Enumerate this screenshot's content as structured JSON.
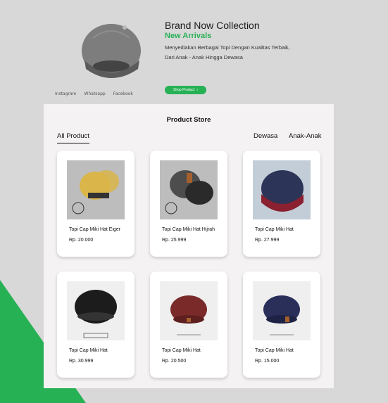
{
  "hero": {
    "title": "Brand Now Collection",
    "subtitle": "New Arrivals",
    "description": "Menyediakan Berbagai Topi Dengan Kualitas Terbaik, Dari Anak - Anak Hingga Dewasa",
    "shop_button": "Shop Product",
    "shop_button_icon": "chevron-right-icon"
  },
  "socials": [
    "Instagram",
    "Whatsapp",
    "Facebook"
  ],
  "store": {
    "title": "Product Store",
    "tabs": [
      "All Product",
      "Dewasa",
      "Anak-Anak"
    ]
  },
  "products": [
    {
      "name": "Topi Cap Miki Hat Eiger",
      "price": "Rp. 20.000",
      "cap_color": "#d9b54a"
    },
    {
      "name": "Topi Cap Miki Hat Hijrah",
      "price": "Rp. 25.999",
      "cap_color": "#4d4d4d"
    },
    {
      "name": "Topi Cap Miki Hat",
      "price": "Rp. 27.999",
      "cap_color": "#2c3557"
    },
    {
      "name": "Topi Cap Miki Hat",
      "price": "Rp. 30.999",
      "cap_color": "#1c1c1c"
    },
    {
      "name": "Topi Cap Miki Hat",
      "price": "Rp. 20.500",
      "cap_color": "#7b2a2a"
    },
    {
      "name": "Topi Cap Miki Hat",
      "price": "Rp. 15.000",
      "cap_color": "#2a2f5a"
    }
  ],
  "colors": {
    "accent": "#27b155",
    "background": "#d8d8d8",
    "panel": "#f4f2f2"
  }
}
